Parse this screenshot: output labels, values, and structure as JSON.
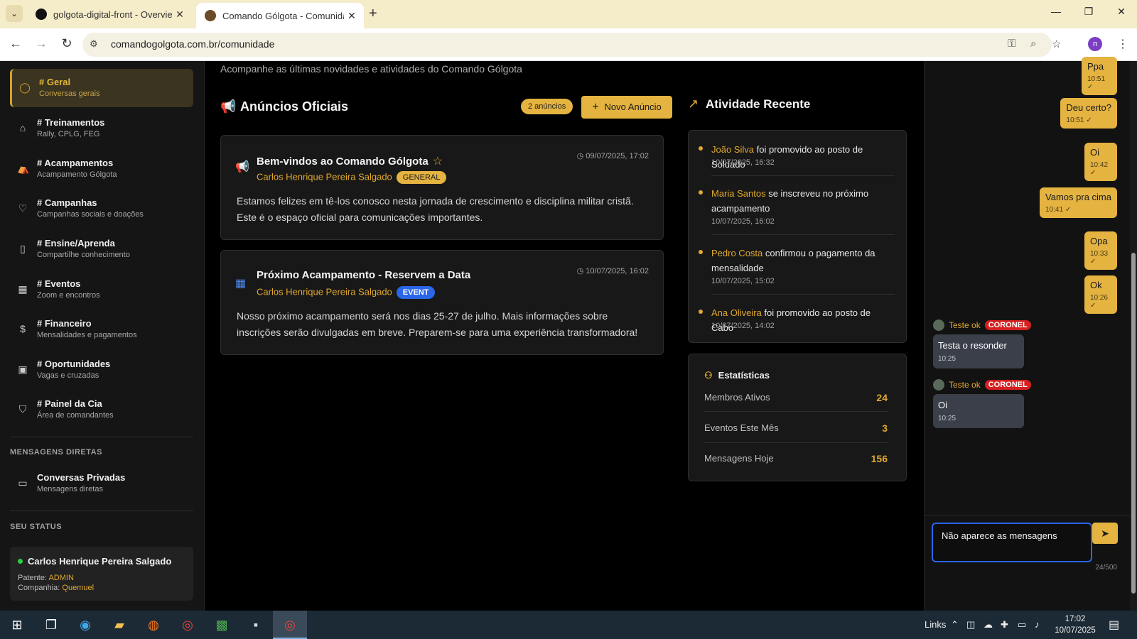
{
  "browser": {
    "tabs": [
      {
        "title": "golgota-digital-front - Overview",
        "active": false
      },
      {
        "title": "Comando Gólgota - Comunidade",
        "active": true
      }
    ],
    "url": "comandogolgota.com.br/comunidade",
    "profile_initial": "n"
  },
  "sidebar": {
    "channels": [
      {
        "name": "# Geral",
        "desc": "Conversas gerais",
        "icon": "chat-bubble-icon",
        "active": true
      },
      {
        "name": "# Treinamentos",
        "desc": "Rally, CPLG, FEG",
        "icon": "graduation-cap-icon",
        "active": false
      },
      {
        "name": "# Acampamentos",
        "desc": "Acampamento Gólgota",
        "icon": "tent-icon",
        "active": false
      },
      {
        "name": "# Campanhas",
        "desc": "Campanhas sociais e doações",
        "icon": "heart-icon",
        "active": false
      },
      {
        "name": "# Ensine/Aprenda",
        "desc": "Compartilhe conhecimento",
        "icon": "book-icon",
        "active": false
      },
      {
        "name": "# Eventos",
        "desc": "Zoom e encontros",
        "icon": "calendar-icon",
        "active": false
      },
      {
        "name": "# Financeiro",
        "desc": "Mensalidades e pagamentos",
        "icon": "dollar-icon",
        "active": false
      },
      {
        "name": "# Oportunidades",
        "desc": "Vagas e cruzadas",
        "icon": "briefcase-icon",
        "active": false
      },
      {
        "name": "# Painel da Cia",
        "desc": "Área de comandantes",
        "icon": "shield-icon",
        "active": false
      }
    ],
    "dm_heading": "MENSAGENS DIRETAS",
    "dm": {
      "name": "Conversas Privadas",
      "desc": "Mensagens diretas"
    },
    "status_heading": "SEU STATUS",
    "status": {
      "name": "Carlos Henrique Pereira Salgado",
      "patente_label": "Patente:",
      "patente": "ADMIN",
      "companhia_label": "Companhia:",
      "companhia": "Quemuel"
    }
  },
  "main": {
    "subtitle": "Acompanhe as últimas novidades e atividades do Comando Gólgota",
    "announcements_title": "Anúncios Oficiais",
    "announcements_count": "2 anúncios",
    "new_button": "Novo Anúncio",
    "announcements": [
      {
        "title": "Bem-vindos ao Comando Gólgota",
        "date": "09/07/2025, 17:02",
        "author": "Carlos Henrique Pereira Salgado",
        "tag": "GENERAL",
        "body": "Estamos felizes em tê-los conosco nesta jornada de crescimento e disciplina militar cristã. Este é o espaço oficial para comunicações importantes."
      },
      {
        "title": "Próximo Acampamento - Reservem a Data",
        "date": "10/07/2025, 16:02",
        "author": "Carlos Henrique Pereira Salgado",
        "tag": "EVENT",
        "body": "Nosso próximo acampamento será nos dias 25-27 de julho. Mais informações sobre inscrições serão divulgadas em breve. Preparem-se para uma experiência transformadora!"
      }
    ],
    "activity_title": "Atividade Recente",
    "activities": [
      {
        "who": "João Silva",
        "text": " foi promovido ao posto de Soldado",
        "time": "10/07/2025, 16:32"
      },
      {
        "who": "Maria Santos",
        "text": " se inscreveu no próximo acampamento",
        "time": "10/07/2025, 16:02"
      },
      {
        "who": "Pedro Costa",
        "text": " confirmou o pagamento da mensalidade",
        "time": "10/07/2025, 15:02"
      },
      {
        "who": "Ana Oliveira",
        "text": " foi promovido ao posto de Cabo",
        "time": "10/07/2025, 14:02"
      }
    ],
    "stats_title": "Estatísticas",
    "stats": [
      {
        "label": "Membros Ativos",
        "value": "24"
      },
      {
        "label": "Eventos Este Mês",
        "value": "3"
      },
      {
        "label": "Mensagens Hoje",
        "value": "156"
      }
    ]
  },
  "chat": {
    "outgoing": [
      {
        "text": "Ppa",
        "time": "10:51 ✓"
      },
      {
        "text": "Deu certo?",
        "time": "10:51 ✓"
      },
      {
        "text": "Oi",
        "time": "10:42 ✓"
      },
      {
        "text": "Vamos pra cima",
        "time": "10:41 ✓"
      },
      {
        "text": "Opa",
        "time": "10:33 ✓"
      },
      {
        "text": "Ok",
        "time": "10:26 ✓"
      }
    ],
    "incoming": [
      {
        "author": "Teste ok",
        "rank": "CORONEL",
        "text": "Testa o resonder",
        "time": "10:25"
      },
      {
        "author": "Teste ok",
        "rank": "CORONEL",
        "text": "Oi",
        "time": "10:25"
      }
    ],
    "input_value": "Não aparece as mensagens",
    "char_count": "24/500"
  },
  "taskbar": {
    "links_label": "Links",
    "time": "17:02",
    "date": "10/07/2025"
  }
}
